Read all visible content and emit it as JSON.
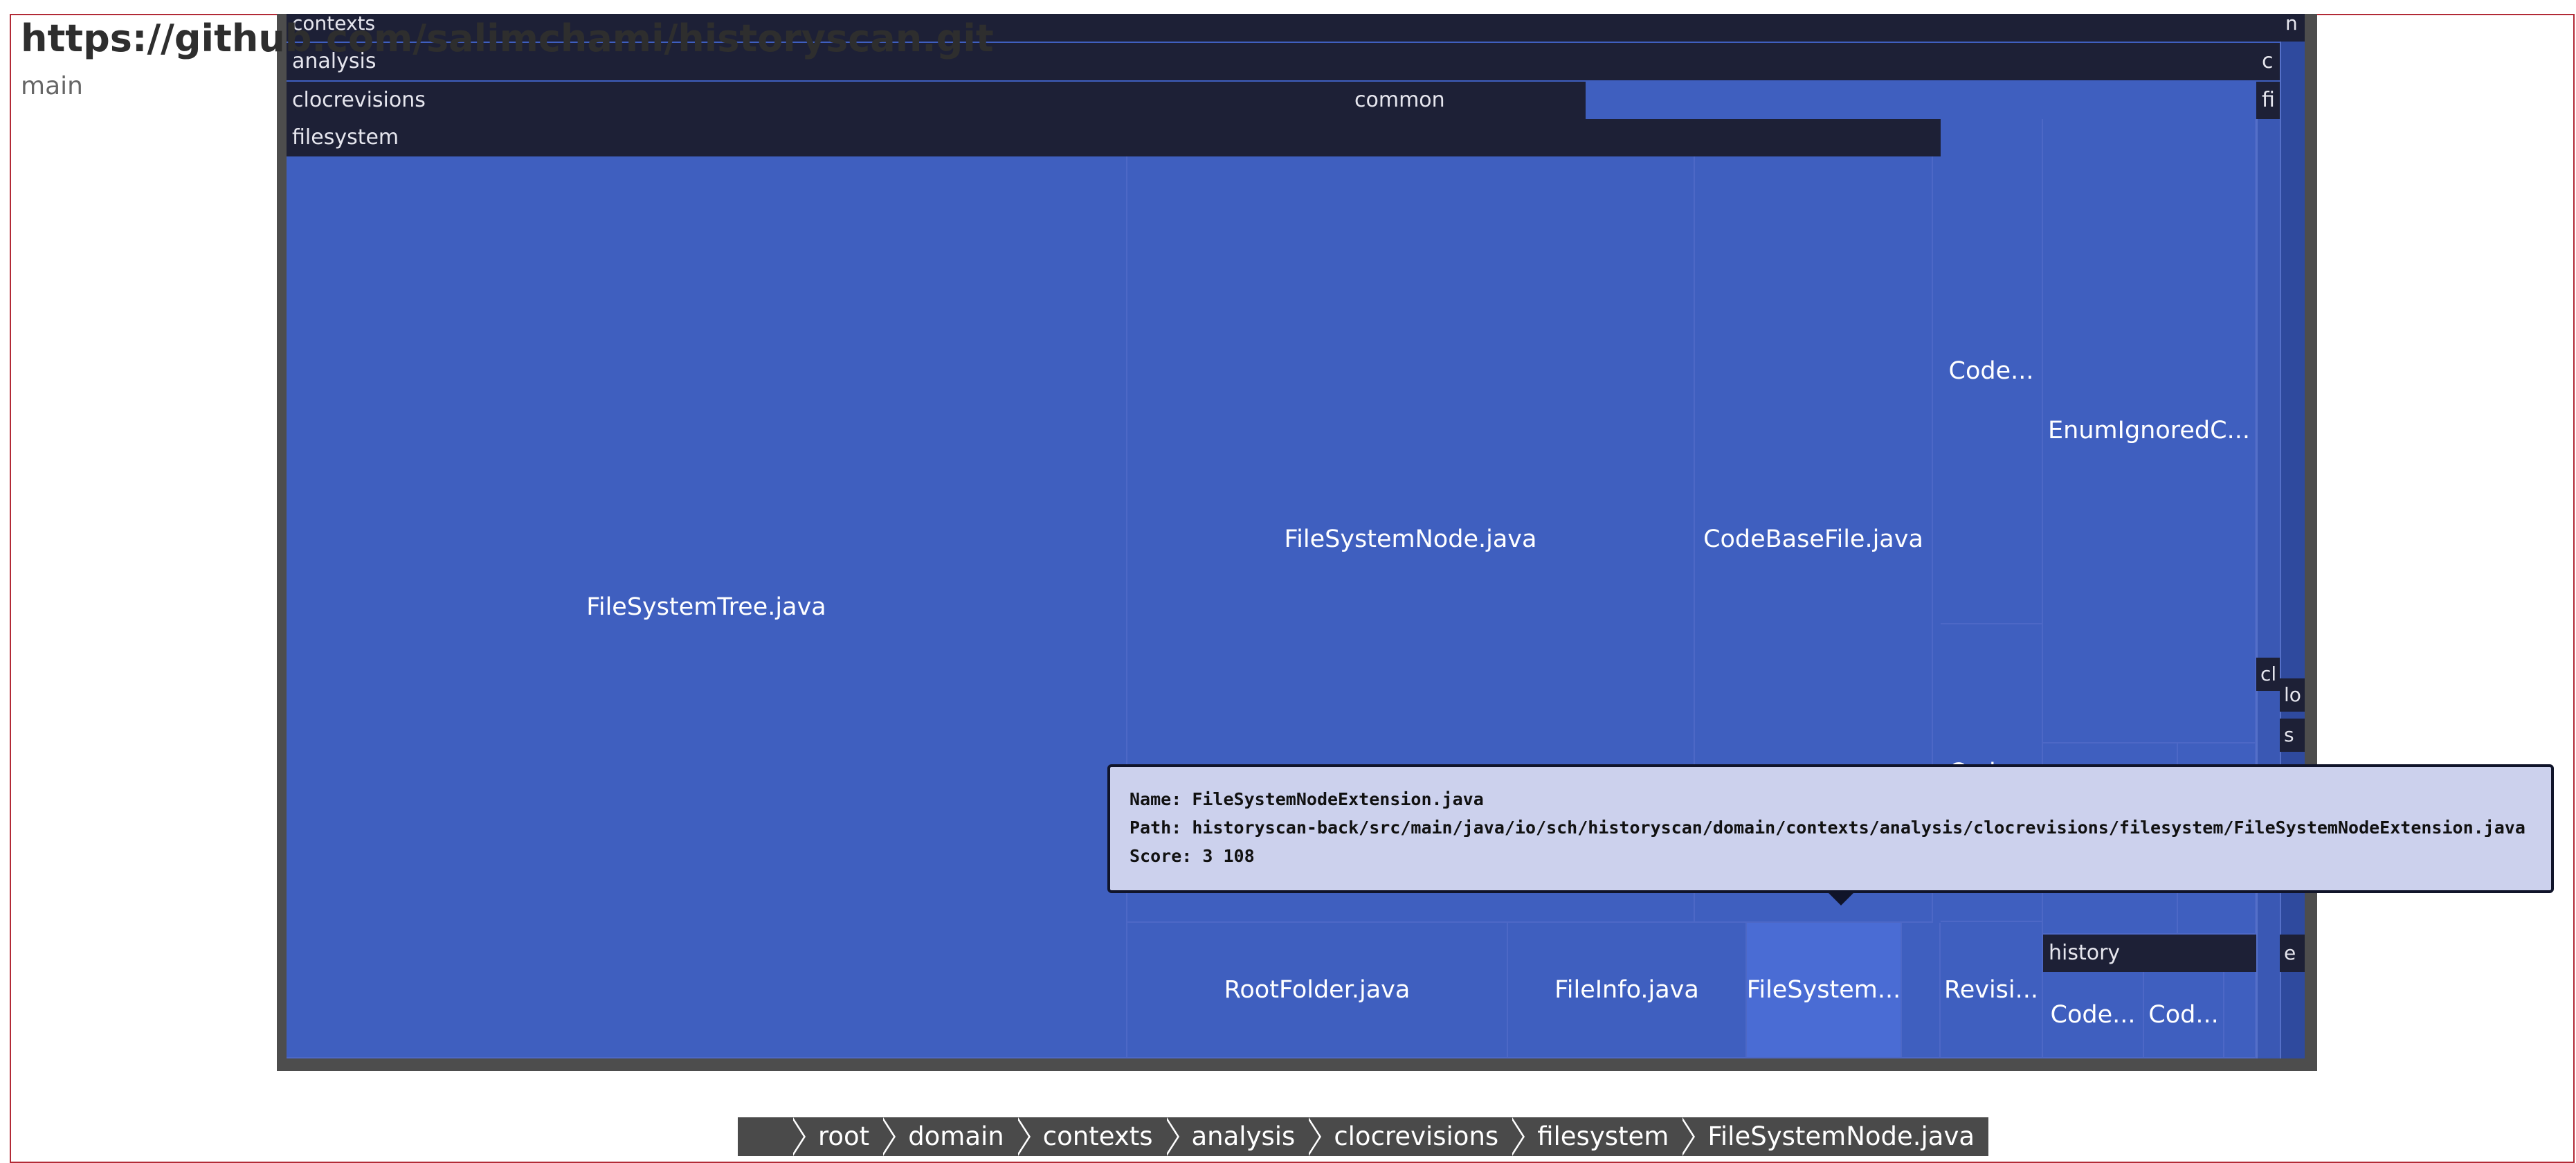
{
  "repo": {
    "url": "https://github.com/salimchami/historyscan.git",
    "branch": "main"
  },
  "treemap": {
    "headers": {
      "contexts": "contexts",
      "analysis": "analysis",
      "analysis_sibling": "c",
      "clocrevisions": "clocrevisions",
      "common": "common",
      "common_sibling": "fi",
      "filesystem": "filesystem",
      "history": "history",
      "right_n": "n",
      "right_cl": "cl",
      "right_lo": "lo",
      "right_s": "s",
      "right_e": "e"
    },
    "files": {
      "tree": "FileSystemTree.java",
      "node": "FileSystemNode.java",
      "codebase": "CodeBaseFile.java",
      "code1": "Code...",
      "code2": "Code...",
      "enum": "EnumIgnoredC...",
      "root": "RootFolder.java",
      "fileinfo": "FileInfo.java",
      "fsext": "FileSystem...",
      "revisi": "Revisi...",
      "codeh1": "Code...",
      "codeh2": "Cod..."
    }
  },
  "tooltip": {
    "name_label": "Name:",
    "name": "FileSystemNodeExtension.java",
    "path_label": "Path:",
    "path": "historyscan-back/src/main/java/io/sch/historyscan/domain/contexts/analysis/clocrevisions/filesystem/FileSystemNodeExtension.java",
    "score_label": "Score:",
    "score": "3 108"
  },
  "breadcrumb": [
    "",
    "root",
    "domain",
    "contexts",
    "analysis",
    "clocrevisions",
    "filesystem",
    "FileSystemNode.java"
  ],
  "colors": {
    "leaf": "#3f5fbf",
    "leaf_highlight": "#4a6cd4",
    "header": "#1d2036",
    "tooltip_bg": "#ccd1ed",
    "frame_border": "#b22a36",
    "breadcrumb_bg": "#4a4a4a"
  }
}
